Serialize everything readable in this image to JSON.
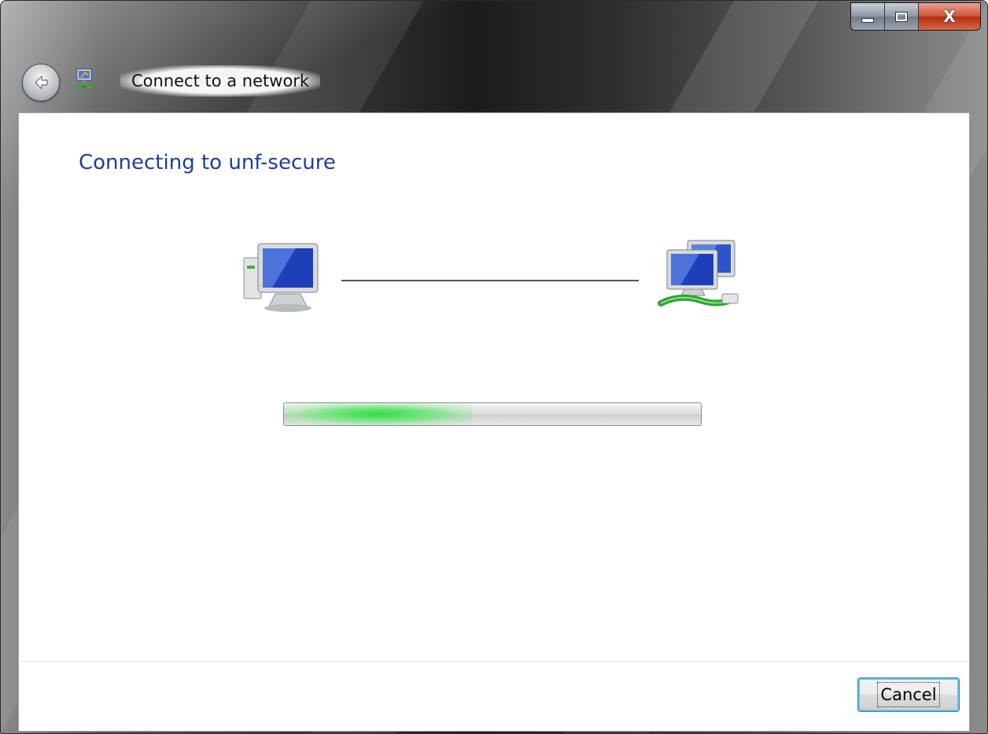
{
  "window": {
    "title": "Connect to a network",
    "caption": {
      "close_glyph": "X"
    }
  },
  "main": {
    "heading": "Connecting to unf-secure",
    "progress": {
      "fraction": 0.45
    }
  },
  "footer": {
    "cancel_label": "Cancel"
  },
  "colors": {
    "heading": "#1e3e9e",
    "progress_glow": "#37d84a",
    "button_focus": "#66c6ec"
  },
  "icons": {
    "back": "back-arrow-icon",
    "app": "network-connection-icon",
    "local": "computer-icon",
    "remote": "network-computers-icon"
  }
}
